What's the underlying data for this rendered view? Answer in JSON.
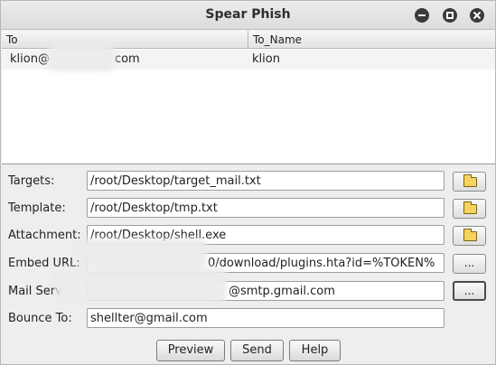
{
  "window": {
    "title": "Spear Phish"
  },
  "table": {
    "columns": [
      "To",
      "To_Name"
    ],
    "rows": [
      {
        "to": "klion@",
        "to_suffix": "com",
        "to_name": "klion"
      }
    ]
  },
  "form": {
    "targets": {
      "label": "Targets:",
      "value": "/root/Desktop/target_mail.txt"
    },
    "template": {
      "label": "Template:",
      "value": "/root/Desktop/tmp.txt"
    },
    "attachment": {
      "label": "Attachment:",
      "value": "/root/Desktop/shell.exe"
    },
    "embed_url": {
      "label": "Embed URL:",
      "value": "0/download/plugins.hta?id=%TOKEN%"
    },
    "mail_server": {
      "label": "Mail Serv",
      "value": "@smtp.gmail.com"
    },
    "bounce_to": {
      "label": "Bounce To:",
      "value": "shellter@gmail.com"
    },
    "browse_label": "..."
  },
  "buttons": {
    "preview": "Preview",
    "send": "Send",
    "help": "Help"
  }
}
